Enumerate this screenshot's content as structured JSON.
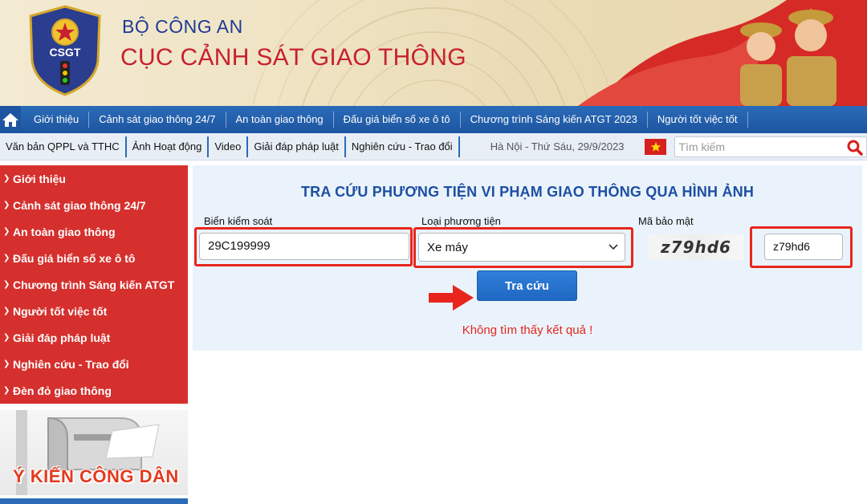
{
  "header": {
    "agency": "BỘ CÔNG AN",
    "department": "CỤC CẢNH SÁT GIAO THÔNG",
    "logo_text": "CSGT"
  },
  "main_nav": {
    "home_icon": "home-icon",
    "items": [
      "Giới thiệu",
      "Cảnh sát giao thông 24/7",
      "An toàn giao thông",
      "Đấu giá biển số xe ô tô",
      "Chương trình Sáng kiến ATGT 2023",
      "Người tốt việc tốt"
    ]
  },
  "sub_nav": {
    "items": [
      "Văn bản QPPL và TTHC",
      "Ảnh Hoạt động",
      "Video",
      "Giải đáp pháp luật",
      "Nghiên cứu - Trao đổi"
    ],
    "date": "Hà Nội - Thứ Sáu, 29/9/2023",
    "search_placeholder": "Tìm kiếm"
  },
  "sidebar": {
    "items": [
      "Giới thiệu",
      "Cảnh sát giao thông 24/7",
      "An toàn giao thông",
      "Đấu giá biển số xe ô tô",
      "Chương trình Sáng kiến ATGT",
      "Người tốt việc tốt",
      "Giải đáp pháp luật",
      "Nghiên cứu - Trao đổi",
      "Đèn đỏ giao thông"
    ],
    "citizen_banner": "Ý KIẾN CÔNG DÂN"
  },
  "lookup": {
    "title": "TRA CỨU PHƯƠNG TIỆN VI PHẠM GIAO THÔNG QUA HÌNH ẢNH",
    "plate_label": "Biển kiểm soát",
    "plate_value": "29C199999",
    "vehicle_label": "Loại phương tiện",
    "vehicle_value": "Xe máy",
    "captcha_label": "Mã bảo mật",
    "captcha_image_text": "z79hd6",
    "captcha_value": "z79hd6",
    "submit_label": "Tra cứu",
    "result_message": "Không tìm thấy kết quả !"
  },
  "colors": {
    "nav_blue": "#1e55a0",
    "sidebar_red": "#d5302d",
    "title_blue": "#1d4fa3",
    "highlight_red": "#e8261e",
    "button_blue": "#1f67c2"
  }
}
